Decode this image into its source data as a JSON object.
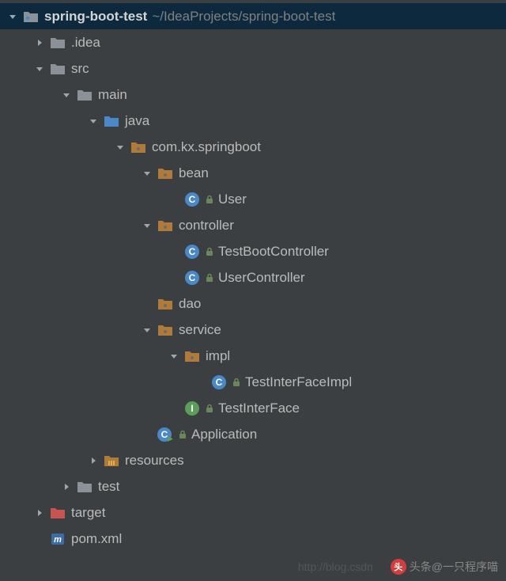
{
  "project": {
    "name": "spring-boot-test",
    "path": "~/IdeaProjects/spring-boot-test"
  },
  "tree": [
    {
      "depth": 0,
      "arrow": "down",
      "icon": "folder-module",
      "label": "spring-boot-test",
      "bold": true,
      "pathKey": "project.path",
      "selected": true
    },
    {
      "depth": 1,
      "arrow": "right",
      "icon": "folder",
      "label": ".idea"
    },
    {
      "depth": 1,
      "arrow": "down",
      "icon": "folder",
      "label": "src"
    },
    {
      "depth": 2,
      "arrow": "down",
      "icon": "folder",
      "label": "main"
    },
    {
      "depth": 3,
      "arrow": "down",
      "icon": "folder-source",
      "label": "java"
    },
    {
      "depth": 4,
      "arrow": "down",
      "icon": "package",
      "label": "com.kx.springboot"
    },
    {
      "depth": 5,
      "arrow": "down",
      "icon": "package",
      "label": "bean"
    },
    {
      "depth": 6,
      "arrow": "none",
      "icon": "class",
      "lock": true,
      "label": "User"
    },
    {
      "depth": 5,
      "arrow": "down",
      "icon": "package",
      "label": "controller"
    },
    {
      "depth": 6,
      "arrow": "none",
      "icon": "class",
      "lock": true,
      "label": "TestBootController"
    },
    {
      "depth": 6,
      "arrow": "none",
      "icon": "class",
      "lock": true,
      "label": "UserController"
    },
    {
      "depth": 5,
      "arrow": "none",
      "icon": "package",
      "label": "dao"
    },
    {
      "depth": 5,
      "arrow": "down",
      "icon": "package",
      "label": "service"
    },
    {
      "depth": 6,
      "arrow": "down",
      "icon": "package",
      "label": "impl"
    },
    {
      "depth": 7,
      "arrow": "none",
      "icon": "class",
      "lock": true,
      "label": "TestInterFaceImpl"
    },
    {
      "depth": 6,
      "arrow": "none",
      "icon": "interface",
      "lock": true,
      "label": "TestInterFace"
    },
    {
      "depth": 5,
      "arrow": "none",
      "icon": "class-run",
      "lock": true,
      "label": "Application"
    },
    {
      "depth": 3,
      "arrow": "right",
      "icon": "folder-resources",
      "label": "resources"
    },
    {
      "depth": 2,
      "arrow": "right",
      "icon": "folder",
      "label": "test"
    },
    {
      "depth": 1,
      "arrow": "right",
      "icon": "folder-excluded",
      "label": "target"
    },
    {
      "depth": 1,
      "arrow": "none",
      "icon": "maven",
      "label": "pom.xml"
    }
  ],
  "watermark": {
    "url": "http://blog.csdn",
    "badge": "头",
    "text": "头条@一只程序喵"
  }
}
